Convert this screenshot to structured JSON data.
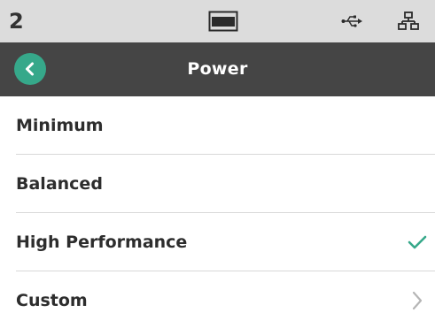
{
  "status_bar": {
    "number": "2",
    "icons": [
      "display-icon",
      "usb-icon",
      "network-icon"
    ]
  },
  "header": {
    "title": "Power",
    "back_icon": "chevron-left-icon"
  },
  "options": [
    {
      "label": "Minimum",
      "selected": false,
      "trailing": "none"
    },
    {
      "label": "Balanced",
      "selected": false,
      "trailing": "none"
    },
    {
      "label": "High Performance",
      "selected": true,
      "trailing": "checkmark-icon"
    },
    {
      "label": "Custom",
      "selected": false,
      "trailing": "chevron-right-icon"
    }
  ],
  "colors": {
    "accent": "#36a88a",
    "header_bg": "#454545",
    "status_bg": "#dcdcdc"
  }
}
